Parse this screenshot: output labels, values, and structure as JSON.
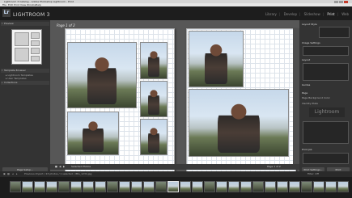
{
  "titlebar": {
    "title": "Lightroom 3 Catalog - Adobe Photoshop Lightroom - Print"
  },
  "menu": [
    "File",
    "Edit",
    "Print",
    "View",
    "Window",
    "Help"
  ],
  "identity": {
    "badge": "Lr",
    "product": "LIGHTROOM 3"
  },
  "modules": [
    "Library",
    "Develop",
    "Slideshow",
    "Print",
    "Web"
  ],
  "active_module": "Print",
  "left_panel": {
    "preview_header": "Preview",
    "sections": [
      "Template Browser",
      "Collections"
    ],
    "button": "Page Setup..."
  },
  "center": {
    "page_label": "Page 1 of 2"
  },
  "right_panel": {
    "rows": [
      "Layout Style",
      "Image Settings",
      "Layout",
      "Guides",
      "Page",
      "Page Background Color",
      "Identity Plate",
      "Print Job"
    ],
    "identity_plate_text": "Lightroom",
    "print_settings_button": "Print Settings...",
    "print_button": "Print"
  },
  "toolbar": {
    "selected": "Selected Photos",
    "page_info": "Page 1 of 2"
  },
  "filmstrip_bar": {
    "source": "Previous Import / 23 photos / 1 selected / IMG_1234.jpg",
    "filter": "Filter: Off"
  },
  "filmstrip": {
    "thumb_count": 28,
    "selected_index": 13
  }
}
